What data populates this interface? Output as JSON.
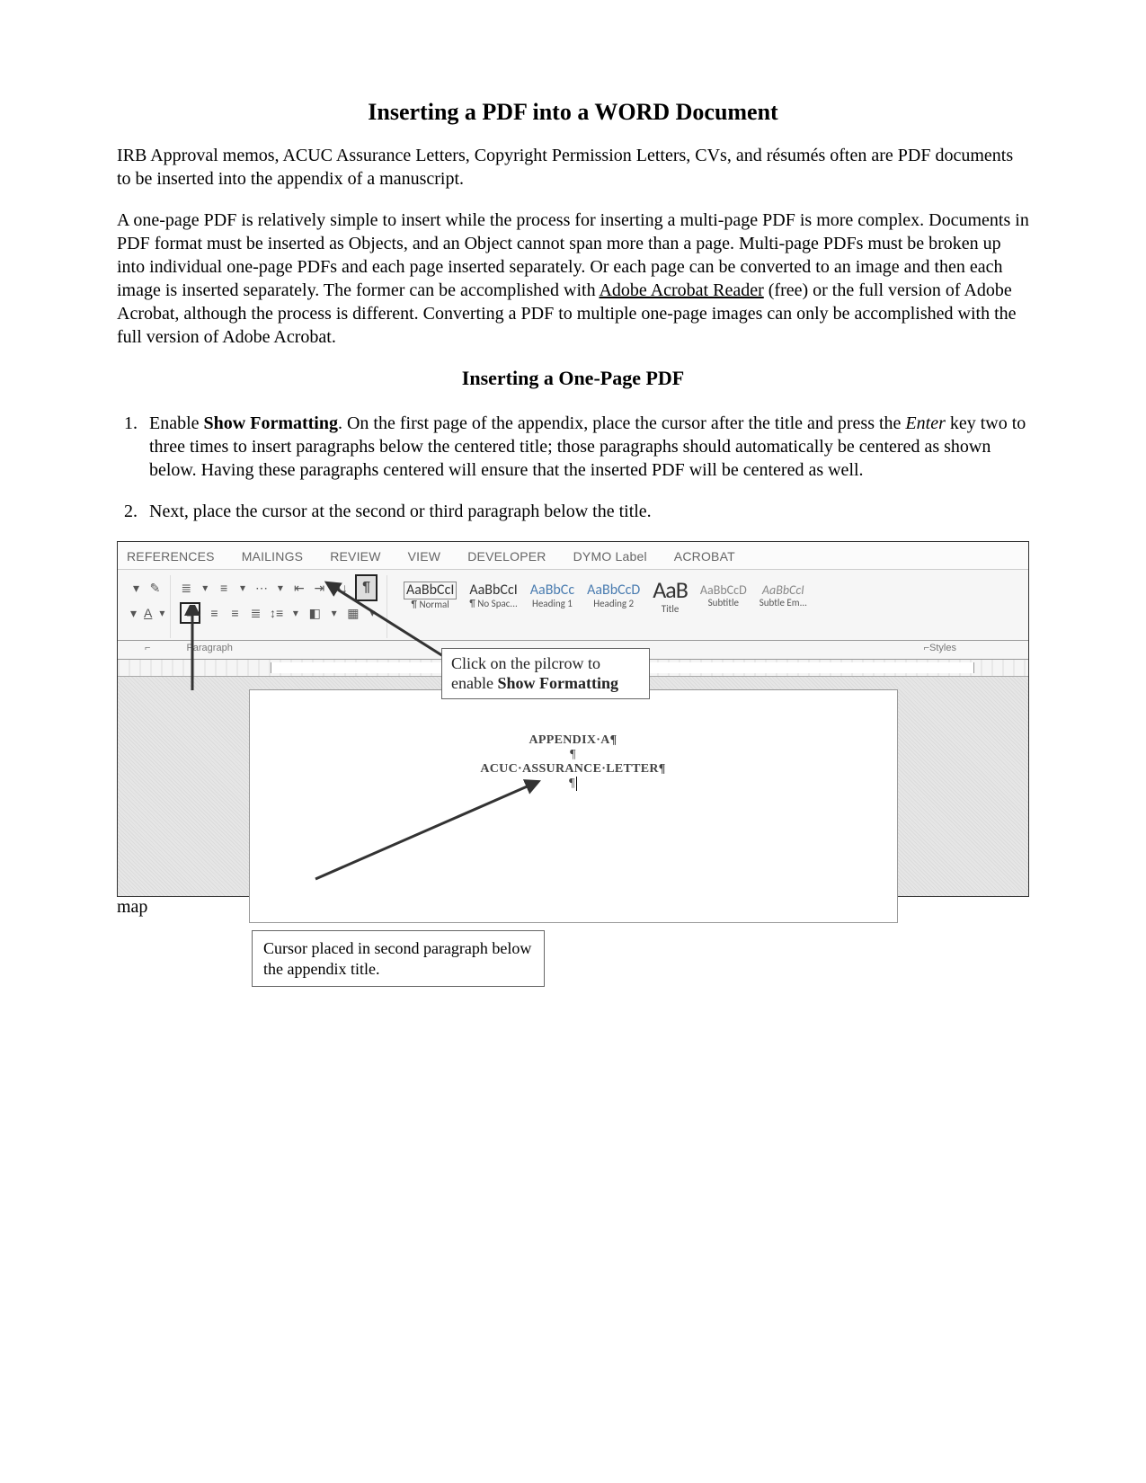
{
  "doc": {
    "title": "Inserting a PDF into a WORD Document",
    "intro1": "IRB Approval memos, ACUC Assurance Letters, Copyright Permission Letters, CVs, and résumés often are PDF documents to be inserted into the appendix of a manuscript.",
    "intro2_a": "A one-page PDF is relatively simple to insert while the process for inserting a multi-page PDF is more complex. Documents in PDF format must be inserted as Objects, and an Object cannot span more than a page. Multi-page PDFs must be broken up into individual one-page PDFs and each page inserted separately. Or each page can be converted to an image and then each image is inserted separately. The former can be accomplished with ",
    "intro2_link": "Adobe Acrobat Reader",
    "intro2_b": " (free) or the full version of Adobe Acrobat, although the process is different. Converting a PDF to multiple one-page images can only be accomplished with the full version of Adobe Acrobat.",
    "subhead": "Inserting a One-Page PDF",
    "step1_a": "Enable ",
    "step1_bold": "Show Formatting",
    "step1_b": ". On the first page of the appendix, place the cursor after the title and press the ",
    "step1_italic": "Enter",
    "step1_c": " key two to three times to insert paragraphs below the centered title; those paragraphs should automatically be centered as shown below. Having these paragraphs centered will ensure that the inserted PDF will be centered as well.",
    "step2": "Next, place the cursor at the second or third paragraph below the title."
  },
  "screenshot": {
    "tabs": [
      "REFERENCES",
      "MAILINGS",
      "REVIEW",
      "VIEW",
      "DEVELOPER",
      "DYMO Label",
      "ACROBAT"
    ],
    "group_paragraph": "Paragraph",
    "group_styles": "Styles",
    "styles": [
      {
        "pv": "AaBbCcI",
        "nm": "¶ Normal",
        "sel": true
      },
      {
        "pv": "AaBbCcI",
        "nm": "¶ No Spac..."
      },
      {
        "pv": "AaBbCc",
        "nm": "Heading 1"
      },
      {
        "pv": "AaBbCcD",
        "nm": "Heading 2"
      },
      {
        "pv": "AaB",
        "nm": "Title",
        "cls": "title"
      },
      {
        "pv": "AaBbCcD",
        "nm": "Subtitle",
        "cls": "subt"
      },
      {
        "pv": "AaBbCcI",
        "nm": "Subtle Em...",
        "cls": "em"
      }
    ],
    "callout1_a": "Click on the pilcrow to enable ",
    "callout1_b": "Show Formatting",
    "doc_line1": "APPENDIX·A¶",
    "doc_line2": "¶",
    "doc_line3": "ACUC·ASSURANCE·LETTER¶",
    "doc_line4": "¶",
    "caption": "Cursor placed in second paragraph below the appendix title."
  }
}
